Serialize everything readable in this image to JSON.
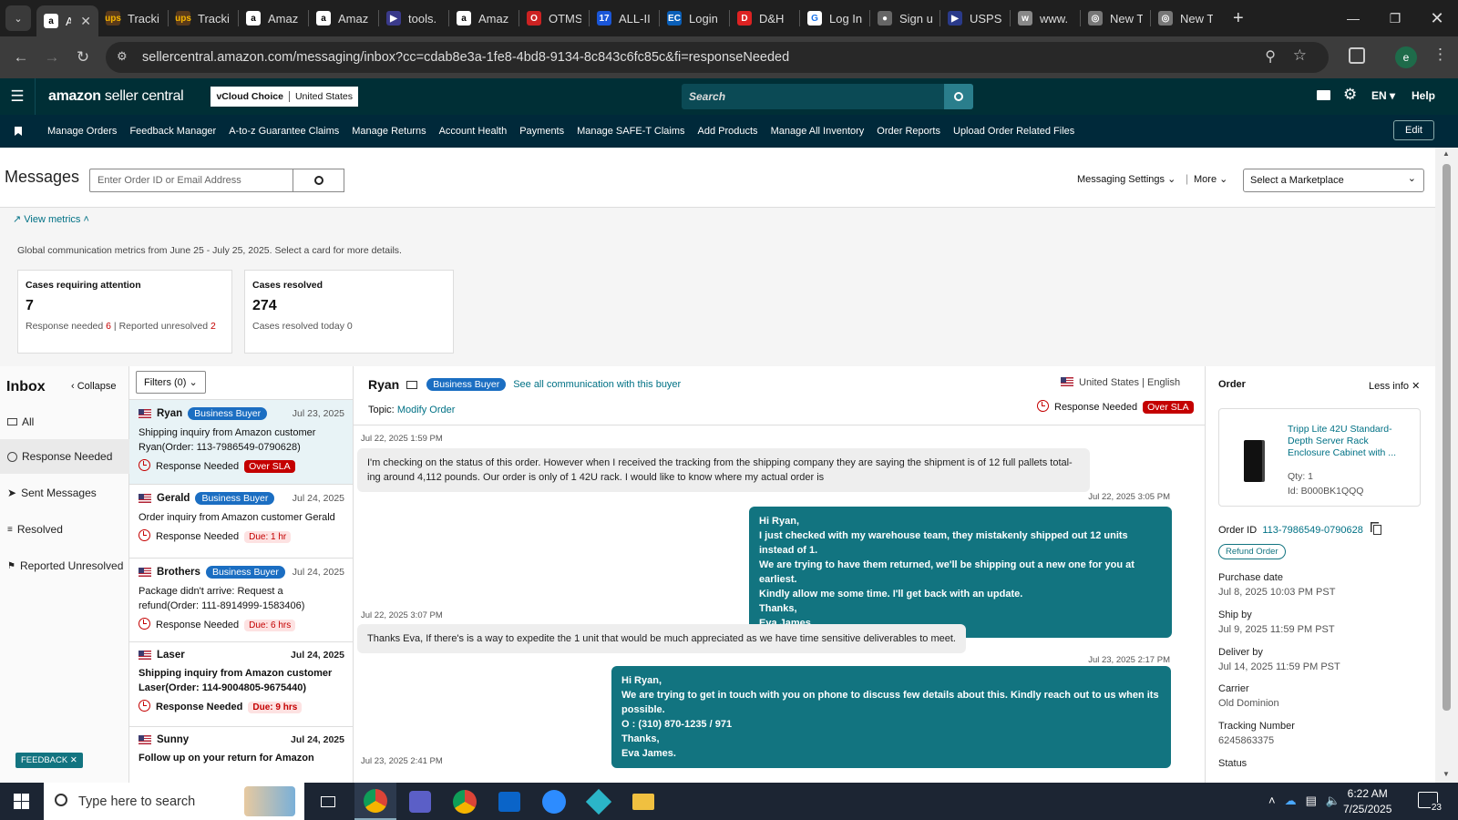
{
  "browser": {
    "tabs": [
      {
        "label": "A",
        "favicon": "amazon",
        "active": true
      },
      {
        "label": "Tracki",
        "favicon": "ups"
      },
      {
        "label": "Tracki",
        "favicon": "ups"
      },
      {
        "label": "Amaz",
        "favicon": "amazon"
      },
      {
        "label": "Amaz",
        "favicon": "amazon"
      },
      {
        "label": "tools.",
        "favicon": "tools"
      },
      {
        "label": "Amaz",
        "favicon": "amazon"
      },
      {
        "label": "OTMS",
        "favicon": "otms"
      },
      {
        "label": "ALL-II",
        "favicon": "17track"
      },
      {
        "label": "Login",
        "favicon": "ec"
      },
      {
        "label": "D&H",
        "favicon": "dh"
      },
      {
        "label": "Log In",
        "favicon": "login"
      },
      {
        "label": "Sign u",
        "favicon": "globe"
      },
      {
        "label": "USPS",
        "favicon": "usps"
      },
      {
        "label": "www.",
        "favicon": "www"
      },
      {
        "label": "New T",
        "favicon": "chrome"
      },
      {
        "label": "New T",
        "favicon": "chrome"
      }
    ],
    "url": "sellercentral.amazon.com/messaging/inbox?cc=cdab8e3a-1fe8-4bd8-9134-8c843c6fc85c&fi=responseNeeded",
    "profile_initial": "e"
  },
  "header": {
    "logo_bold": "amazon",
    "logo_rest": " seller central",
    "account": "vCloud Choice",
    "marketplace": "United States",
    "search_placeholder": "Search",
    "language": "EN",
    "help": "Help"
  },
  "nav": {
    "items": [
      "Manage Orders",
      "Feedback Manager",
      "A-to-z Guarantee Claims",
      "Manage Returns",
      "Account Health",
      "Payments",
      "Manage SAFE-T Claims",
      "Add Products",
      "Manage All Inventory",
      "Order Reports",
      "Upload Order Related Files"
    ],
    "edit": "Edit"
  },
  "messages": {
    "title": "Messages",
    "search_placeholder": "Enter Order ID or Email Address",
    "settings": "Messaging Settings",
    "more": "More",
    "marketplace_select": "Select a Marketplace"
  },
  "metrics": {
    "toggle": "View metrics",
    "description": "Global communication metrics from June 25 - July 25, 2025. Select a card for more details.",
    "attention": {
      "title": "Cases requiring attention",
      "value": "7",
      "sub1": "Response needed",
      "sub1_val": "6",
      "sub2": "Reported unresolved",
      "sub2_val": "2"
    },
    "resolved": {
      "title": "Cases resolved",
      "value": "274",
      "sub": "Cases resolved today 0"
    }
  },
  "inbox": {
    "title": "Inbox",
    "collapse": "Collapse",
    "filters": "Filters (0)",
    "nav": [
      "All",
      "Response Needed",
      "Sent Messages",
      "Resolved",
      "Reported Unresolved"
    ]
  },
  "threads": [
    {
      "name": "Ryan",
      "badge": "Business Buyer",
      "date": "Jul 23, 2025",
      "subject": "Shipping inquiry from Amazon customer Ryan(Order: 113-7986549-0790628)",
      "status": "Response Needed",
      "tag": "Over SLA",
      "unread": false
    },
    {
      "name": "Gerald",
      "badge": "Business Buyer",
      "date": "Jul 24, 2025",
      "subject": "Order inquiry from Amazon customer Gerald",
      "status": "Response Needed",
      "tag": "Due: 1 hr",
      "unread": false
    },
    {
      "name": "Brothers",
      "badge": "Business Buyer",
      "date": "Jul 24, 2025",
      "subject": "Package didn't arrive: Request a refund(Order: 111-8914999-1583406)",
      "status": "Response Needed",
      "tag": "Due: 6 hrs",
      "unread": false
    },
    {
      "name": "Laser",
      "badge": "",
      "date": "Jul 24, 2025",
      "subject": "Shipping inquiry from Amazon customer Laser(Order: 114-9004805-9675440)",
      "status": "Response Needed",
      "tag": "Due: 9 hrs",
      "unread": true
    },
    {
      "name": "Sunny",
      "badge": "",
      "date": "Jul 24, 2025",
      "subject": "Follow up on your return for Amazon",
      "status": "",
      "tag": "",
      "unread": true
    }
  ],
  "conversation": {
    "buyer": "Ryan",
    "badge": "Business Buyer",
    "see_all": "See all communication with this buyer",
    "country": "United States",
    "language": "English",
    "topic_label": "Topic:",
    "topic": "Modify Order",
    "status": "Response Needed",
    "sla": "Over SLA",
    "messages": [
      {
        "side": "buyer",
        "time": "Jul 22, 2025 1:59 PM",
        "text": "I'm checking on the status of this order. However when I received the tracking from the shipping company they are saying the shipment is of 12 full pallets total-ing around 4,112 pounds. Our order is only of 1 42U rack. I would like to know where my actual order is"
      },
      {
        "side": "seller",
        "time": "Jul 22, 2025 3:05 PM",
        "lines": [
          "Hi Ryan,",
          "I just checked with my warehouse team, they mistakenly shipped out 12 units instead of 1.",
          "We are trying to have them returned, we'll be shipping out a new one for you at earliest.",
          "Kindly allow me some time. I'll get back with an update.",
          "Thanks,",
          "Eva James."
        ]
      },
      {
        "side": "buyer",
        "time": "Jul 22, 2025 3:07 PM",
        "text": "Thanks Eva, If there's is a way to expedite the 1 unit that would be much appreciated as we have time sensitive deliverables to meet."
      },
      {
        "side": "seller",
        "time": "Jul 23, 2025 2:17 PM",
        "lines": [
          "Hi Ryan,",
          "We are trying to get in touch with you on phone to discuss few details about this. Kindly reach out to us when its possible.",
          "O : (310) 870-1235 / 971",
          "Thanks,",
          "Eva James."
        ]
      },
      {
        "side": "buyer",
        "time": "Jul 23, 2025 2:41 PM",
        "text": ""
      }
    ]
  },
  "order": {
    "title": "Order",
    "less_info": "Less info",
    "product_title": "Tripp Lite 42U Standard-Depth Server Rack Enclosure Cabinet with ...",
    "qty": "Qty: 1",
    "id": "Id: B000BK1QQQ",
    "order_id_label": "Order ID",
    "order_id": "113-7986549-0790628",
    "refund": "Refund Order",
    "fields": [
      {
        "label": "Purchase date",
        "value": "Jul 8, 2025 10:03 PM PST"
      },
      {
        "label": "Ship by",
        "value": "Jul 9, 2025 11:59 PM PST"
      },
      {
        "label": "Deliver by",
        "value": "Jul 14, 2025 11:59 PM PST"
      },
      {
        "label": "Carrier",
        "value": "Old Dominion"
      },
      {
        "label": "Tracking Number",
        "value": "6245863375"
      },
      {
        "label": "Status",
        "value": ""
      }
    ]
  },
  "feedback": "FEEDBACK",
  "taskbar": {
    "search_placeholder": "Type here to search",
    "time": "6:22 AM",
    "date": "7/25/2025",
    "notifications": "23"
  },
  "colors": {
    "header": "#002f36",
    "nav": "#00293a",
    "seller_bubble": "#127480",
    "badge": "#1b6ec2",
    "alert": "#c40000",
    "link": "#007185"
  }
}
